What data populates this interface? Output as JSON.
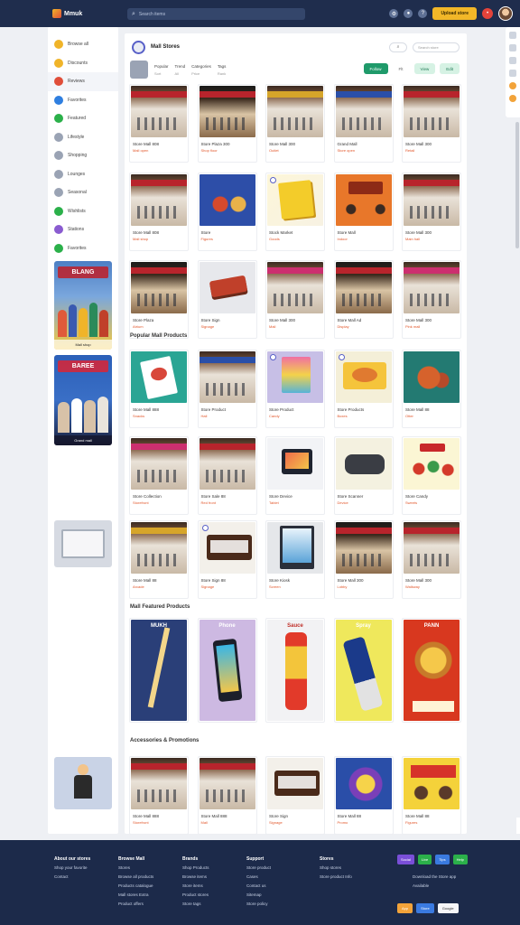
{
  "topbar": {
    "brand": "Mmuk",
    "search_placeholder": "Search items",
    "cta_label": "Upload store",
    "bell_icon": "bell-icon",
    "cta_color": "#f2b728",
    "bar_color": "#1f2d4d"
  },
  "sidebar": {
    "items": [
      {
        "label": "Browse all",
        "icon": "store-icon",
        "color": "#f0b429"
      },
      {
        "label": "Discounts",
        "icon": "tag-icon",
        "color": "#f0b429"
      },
      {
        "label": "Reviews",
        "icon": "chat-icon",
        "color": "#e04e39"
      },
      {
        "label": "Favorites",
        "icon": "heart-icon",
        "color": "#2f7fe0"
      },
      {
        "label": "Featured",
        "icon": "star-icon",
        "color": "#2bb04a"
      },
      {
        "label": "Lifestyle",
        "icon": "leaf-icon",
        "color": "#9aa3b4"
      },
      {
        "label": "Shopping",
        "icon": "bag-icon",
        "color": "#9aa3b4"
      },
      {
        "label": "Lounges",
        "icon": "sofa-icon",
        "color": "#9aa3b4"
      },
      {
        "label": "Seasonal",
        "icon": "calendar-icon",
        "color": "#9aa3b4"
      },
      {
        "label": "Wishlists",
        "icon": "list-icon",
        "color": "#2bb04a"
      },
      {
        "label": "Stations",
        "icon": "pin-icon",
        "color": "#8a5cd0"
      },
      {
        "label": "Favorites",
        "icon": "cloud-icon",
        "color": "#2bb04a"
      }
    ],
    "promo1_title": "BLANG",
    "promo1_foot": "Mall shop",
    "promo2_title": "BAREE",
    "promo2_foot": "Grand mall"
  },
  "main": {
    "title": "Mall Stores",
    "search_placeholder": "Search store",
    "filter_cols": [
      {
        "top": "Popular",
        "bottom": "Sort"
      },
      {
        "top": "Trend",
        "bottom": "All"
      },
      {
        "top": "Categories",
        "bottom": "Price"
      },
      {
        "top": "Tags",
        "bottom": "Rank"
      }
    ],
    "btn_primary": "Follow",
    "btn_plain": "Flt",
    "btn_light": "View",
    "btn_extra": "Edit",
    "row1": [
      {
        "title": "Store Mall 808",
        "sub": "Mall open"
      },
      {
        "title": "Store Plaza 300",
        "sub": "Shop floor"
      },
      {
        "title": "Store Mall 300",
        "sub": "Outlet"
      },
      {
        "title": "Grand Mall",
        "sub": "Store open"
      },
      {
        "title": "Store Mall 300",
        "sub": "Retail"
      }
    ],
    "row2": [
      {
        "title": "Store Mall 808",
        "sub": "Mall shop"
      },
      {
        "title": "Store",
        "sub": "Figures"
      },
      {
        "title": "Stock Market",
        "sub": "Goods"
      },
      {
        "title": "Store Mall",
        "sub": "Indoor"
      },
      {
        "title": "Store Mall 300",
        "sub": "Main hall"
      }
    ],
    "row3": [
      {
        "title": "Store Plaza",
        "sub": "Atrium"
      },
      {
        "title": "Store Sign",
        "sub": "Signage"
      },
      {
        "title": "Store Mall 300",
        "sub": "Mall"
      },
      {
        "title": "Store Mall Ad",
        "sub": "Display"
      },
      {
        "title": "Store Mall 300",
        "sub": "Pink mall"
      }
    ],
    "section1": "Popular Mall Products",
    "row4": [
      {
        "title": "Store Mall 888",
        "sub": "Snacks"
      },
      {
        "title": "Store Product",
        "sub": "Hall"
      },
      {
        "title": "Store Product",
        "sub": "Candy"
      },
      {
        "title": "Store Products",
        "sub": "Boxes"
      },
      {
        "title": "Store Mall 88",
        "sub": "Otter"
      }
    ],
    "row5": [
      {
        "title": "Store Collection",
        "sub": "Storefront"
      },
      {
        "title": "Store Sale 88",
        "sub": "Red front"
      },
      {
        "title": "Store Device",
        "sub": "Tablet"
      },
      {
        "title": "Store Scanner",
        "sub": "Device"
      },
      {
        "title": "Store Candy",
        "sub": "Sweets"
      }
    ],
    "row6": [
      {
        "title": "Store Mall 88",
        "sub": "Arcade"
      },
      {
        "title": "Store Sign 88",
        "sub": "Signage"
      },
      {
        "title": "Store Kiosk",
        "sub": "Screen"
      },
      {
        "title": "Store Mall 300",
        "sub": "Lobby"
      },
      {
        "title": "Store Mall 300",
        "sub": "Walkway"
      }
    ],
    "section2": "Mall Featured Products",
    "tall_titles": [
      "MUKH",
      "Phone",
      "Sauce",
      "Spray",
      "PANN"
    ],
    "section3": "Accessories & Promotions",
    "row7": [
      {
        "title": "Store Mall 888",
        "sub": "Storefront"
      },
      {
        "title": "Store Mall 888",
        "sub": "Mall"
      },
      {
        "title": "Store Sign",
        "sub": "Signage"
      },
      {
        "title": "Store Mall 88",
        "sub": "Promo"
      },
      {
        "title": "Store Mall 88",
        "sub": "Figures"
      }
    ]
  },
  "footer": {
    "columns": [
      {
        "head": "About our stores",
        "items": [
          "Shop your favorite",
          "Contact"
        ]
      },
      {
        "head": "Browse Mall",
        "items": [
          "Stores",
          "Browse all products",
          "Products catalogue",
          "Mall stores Extra",
          "Product offers"
        ]
      },
      {
        "head": "Brands",
        "items": [
          "Shop Products",
          "Browse items",
          "Store items",
          "Product stores",
          "Store tags"
        ]
      },
      {
        "head": "Support",
        "items": [
          "Store product",
          "Cases",
          "Contact us",
          "Sitemap",
          "Store policy"
        ]
      },
      {
        "head": "Stores",
        "items": [
          "Shop stores",
          "Store product Info"
        ]
      }
    ],
    "badges": [
      "Social",
      "Live",
      "Tips",
      "Help"
    ],
    "badge_colors": [
      "#7a4fd8",
      "#2bb04a",
      "#3a7ae0",
      "#2bb04a"
    ],
    "store_note": "Download the Store app",
    "store_note2": "Available",
    "app_labels": [
      "App",
      "Store",
      "Google"
    ]
  }
}
